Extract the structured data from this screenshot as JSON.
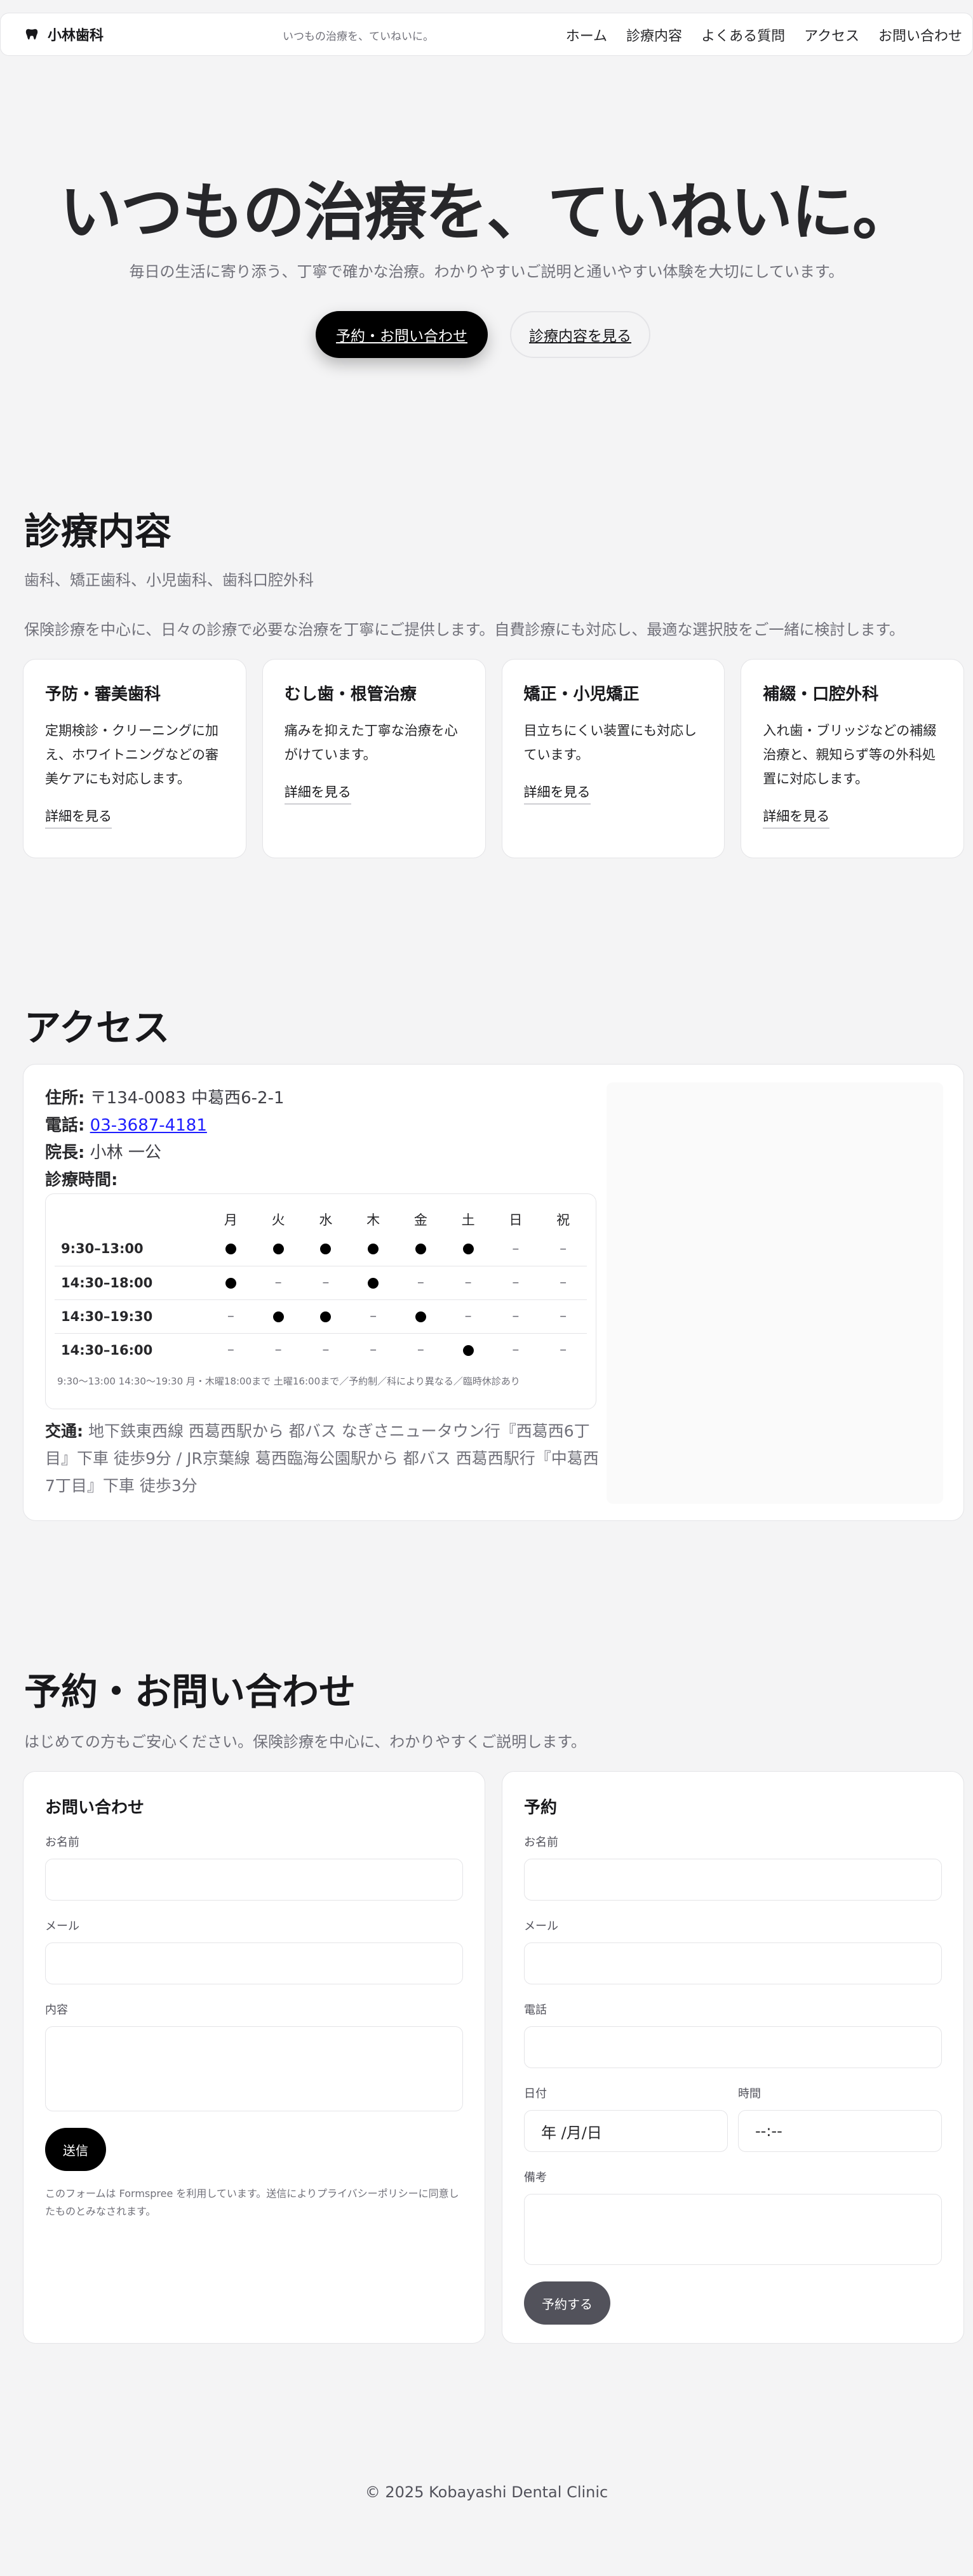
{
  "header": {
    "brand": "小林歯科",
    "tagline": "いつもの治療を、ていねいに。",
    "nav": [
      "ホーム",
      "診療内容",
      "よくある質問",
      "アクセス",
      "お問い合わせ"
    ]
  },
  "hero": {
    "title": "いつもの治療を、ていねいに。",
    "subtitle": "毎日の生活に寄り添う、丁寧で確かな治療。わかりやすいご説明と通いやすい体験を大切にしています。",
    "primary_button": "予約・お問い合わせ",
    "secondary_button": "診療内容を見る"
  },
  "services": {
    "heading": "診療内容",
    "specialties": "歯科、矯正歯科、小児歯科、歯科口腔外科",
    "intro": "保険診療を中心に、日々の診療で必要な治療を丁寧にご提供します。自費診療にも対応し、最適な選択肢をご一緒に検討します。",
    "cards": [
      {
        "title": "予防・審美歯科",
        "text": "定期検診・クリーニングに加え、ホワイトニングなどの審美ケアにも対応します。",
        "link": "詳細を見る"
      },
      {
        "title": "むし歯・根管治療",
        "text": "痛みを抑えた丁寧な治療を心がけています。",
        "link": "詳細を見る"
      },
      {
        "title": "矯正・小児矯正",
        "text": "目立ちにくい装置にも対応しています。",
        "link": "詳細を見る"
      },
      {
        "title": "補綴・口腔外科",
        "text": "入れ歯・ブリッジなどの補綴治療と、親知らず等の外科処置に対応します。",
        "link": "詳細を見る"
      }
    ]
  },
  "access": {
    "heading": "アクセス",
    "address_label": "住所:",
    "address": "〒134-0083 中葛西6-2-1",
    "phone_label": "電話:",
    "phone": "03-3687-4181",
    "director_label": "院長:",
    "director": "小林 一公",
    "hours_label": "診療時間:",
    "days": [
      "月",
      "火",
      "水",
      "木",
      "金",
      "土",
      "日",
      "祝"
    ],
    "schedule": [
      {
        "time": "9:30–13:00",
        "open": [
          true,
          true,
          true,
          true,
          true,
          true,
          false,
          false
        ]
      },
      {
        "time": "14:30–18:00",
        "open": [
          true,
          false,
          false,
          true,
          false,
          false,
          false,
          false
        ]
      },
      {
        "time": "14:30–19:30",
        "open": [
          false,
          true,
          true,
          false,
          true,
          false,
          false,
          false
        ]
      },
      {
        "time": "14:30–16:00",
        "open": [
          false,
          false,
          false,
          false,
          false,
          true,
          false,
          false
        ]
      }
    ],
    "closed_mark": "–",
    "hours_note": "9:30〜13:00 14:30〜19:30 月・木曜18:00まで 土曜16:00まで／予約制／科により異なる／臨時休診あり",
    "transit_label": "交通:",
    "transit": "地下鉄東西線 西葛西駅から 都バス なぎさニュータウン行『西葛西6丁目』下車 徒歩9分 / JR京葉線 葛西臨海公園駅から 都バス 西葛西駅行『中葛西7丁目』下車 徒歩3分"
  },
  "contact": {
    "heading": "予約・お問い合わせ",
    "intro": "はじめての方もご安心ください。保険診療を中心に、わかりやすくご説明します。",
    "inquiry": {
      "title": "お問い合わせ",
      "name_label": "お名前",
      "email_label": "メール",
      "message_label": "内容",
      "submit": "送信",
      "notice": "このフォームは Formspree を利用しています。送信によりプライバシーポリシーに同意したものとみなされます。"
    },
    "reservation": {
      "title": "予約",
      "name_label": "お名前",
      "email_label": "メール",
      "phone_label": "電話",
      "date_label": "日付",
      "date_value": "年 /月/日",
      "time_label": "時間",
      "time_value": "--:--",
      "notes_label": "備考",
      "submit": "予約する"
    }
  },
  "footer": {
    "copyright": "© 2025 Kobayashi Dental Clinic"
  }
}
